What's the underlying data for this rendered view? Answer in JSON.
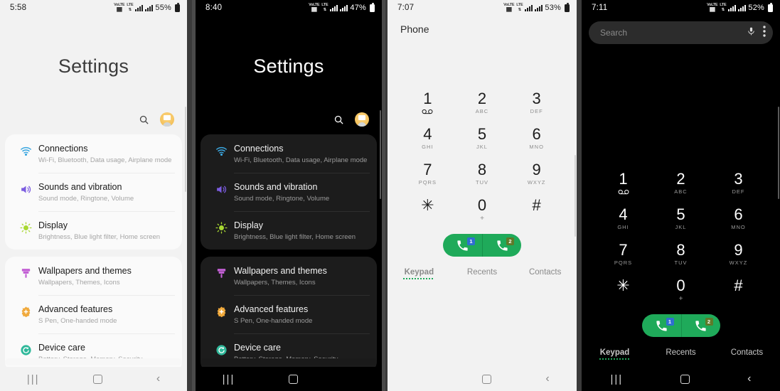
{
  "panels": [
    {
      "id": "settings-light",
      "theme": "light",
      "status": {
        "time": "5:58",
        "battery": "55%",
        "net1": "VoLTE",
        "net2": "LTE"
      },
      "title": "Settings",
      "actions": {
        "search": "search-icon",
        "avatar": "account-avatar"
      },
      "groups": [
        {
          "items": [
            {
              "title": "Connections",
              "sub": "Wi-Fi, Bluetooth, Data usage, Airplane mode",
              "icon": "wifi-icon",
              "color": "#3ba7e0"
            },
            {
              "title": "Sounds and vibration",
              "sub": "Sound mode, Ringtone, Volume",
              "icon": "speaker-icon",
              "color": "#7b5ce0"
            },
            {
              "title": "Display",
              "sub": "Brightness, Blue light filter, Home screen",
              "icon": "brightness-icon",
              "color": "#a8d832"
            }
          ]
        },
        {
          "items": [
            {
              "title": "Wallpapers and themes",
              "sub": "Wallpapers, Themes, Icons",
              "icon": "paintbrush-icon",
              "color": "#c25fd4"
            },
            {
              "title": "Advanced features",
              "sub": "S Pen, One-handed mode",
              "icon": "gear-plus-icon",
              "color": "#f0a93b"
            },
            {
              "title": "Device care",
              "sub": "Battery, Storage, Memory, Security",
              "icon": "refresh-shield-icon",
              "color": "#2fb89a"
            }
          ]
        }
      ],
      "nav": {
        "recent": "recents-icon",
        "home": "home-icon",
        "back": "back-icon"
      }
    },
    {
      "id": "settings-dark",
      "theme": "dark",
      "status": {
        "time": "8:40",
        "battery": "47%",
        "net1": "VoLTE",
        "net2": "LTE"
      },
      "title": "Settings",
      "actions": {
        "search": "search-icon",
        "avatar": "account-avatar"
      },
      "groups": [
        {
          "items": [
            {
              "title": "Connections",
              "sub": "Wi-Fi, Bluetooth, Data usage, Airplane mode",
              "icon": "wifi-icon",
              "color": "#3ba7e0"
            },
            {
              "title": "Sounds and vibration",
              "sub": "Sound mode, Ringtone, Volume",
              "icon": "speaker-icon",
              "color": "#7b5ce0"
            },
            {
              "title": "Display",
              "sub": "Brightness, Blue light filter, Home screen",
              "icon": "brightness-icon",
              "color": "#a8d832"
            }
          ]
        },
        {
          "items": [
            {
              "title": "Wallpapers and themes",
              "sub": "Wallpapers, Themes, Icons",
              "icon": "paintbrush-icon",
              "color": "#c25fd4"
            },
            {
              "title": "Advanced features",
              "sub": "S Pen, One-handed mode",
              "icon": "gear-plus-icon",
              "color": "#f0a93b"
            },
            {
              "title": "Device care",
              "sub": "Battery, Storage, Memory, Security",
              "icon": "refresh-shield-icon",
              "color": "#2fb89a"
            }
          ]
        }
      ],
      "nav": {
        "recent": "recents-icon",
        "home": "home-icon",
        "back": "back-icon"
      }
    },
    {
      "id": "dialer-light",
      "theme": "light",
      "status": {
        "time": "7:07",
        "battery": "53%",
        "net1": "VoLTE",
        "net2": "LTE"
      },
      "app_title": "Phone",
      "keys": [
        {
          "num": "1",
          "sub": "voicemail-icon"
        },
        {
          "num": "2",
          "sub": "ABC"
        },
        {
          "num": "3",
          "sub": "DEF"
        },
        {
          "num": "4",
          "sub": "GHI"
        },
        {
          "num": "5",
          "sub": "JKL"
        },
        {
          "num": "6",
          "sub": "MNO"
        },
        {
          "num": "7",
          "sub": "PQRS"
        },
        {
          "num": "8",
          "sub": "TUV"
        },
        {
          "num": "9",
          "sub": "WXYZ"
        },
        {
          "num": "✳",
          "sub": ""
        },
        {
          "num": "0",
          "sub": "+"
        },
        {
          "num": "#",
          "sub": ""
        }
      ],
      "call": {
        "sim1": "1",
        "sim2": "2",
        "icon": "call-icon",
        "color": "#1faa5a"
      },
      "tabs": [
        {
          "label": "Keypad",
          "active": true
        },
        {
          "label": "Recents",
          "active": false
        },
        {
          "label": "Contacts",
          "active": false
        }
      ],
      "nav": {
        "recent": "recents-icon",
        "home": "home-icon",
        "back": "back-icon"
      }
    },
    {
      "id": "dialer-dark",
      "theme": "dark",
      "status": {
        "time": "7:11",
        "battery": "52%",
        "net1": "VoLTE",
        "net2": "LTE"
      },
      "search": {
        "placeholder": "Search",
        "mic": "microphone-icon",
        "more": "more-options-icon"
      },
      "keys": [
        {
          "num": "1",
          "sub": "voicemail-icon"
        },
        {
          "num": "2",
          "sub": "ABC"
        },
        {
          "num": "3",
          "sub": "DEF"
        },
        {
          "num": "4",
          "sub": "GHI"
        },
        {
          "num": "5",
          "sub": "JKL"
        },
        {
          "num": "6",
          "sub": "MNO"
        },
        {
          "num": "7",
          "sub": "PQRS"
        },
        {
          "num": "8",
          "sub": "TUV"
        },
        {
          "num": "9",
          "sub": "WXYZ"
        },
        {
          "num": "✳",
          "sub": ""
        },
        {
          "num": "0",
          "sub": "+"
        },
        {
          "num": "#",
          "sub": ""
        }
      ],
      "call": {
        "sim1": "1",
        "sim2": "2",
        "icon": "call-icon",
        "color": "#1faa5a"
      },
      "tabs": [
        {
          "label": "Keypad",
          "active": true
        },
        {
          "label": "Recents",
          "active": false
        },
        {
          "label": "Contacts",
          "active": false
        }
      ],
      "nav": {
        "recent": "recents-icon",
        "home": "home-icon",
        "back": "back-icon"
      }
    }
  ]
}
